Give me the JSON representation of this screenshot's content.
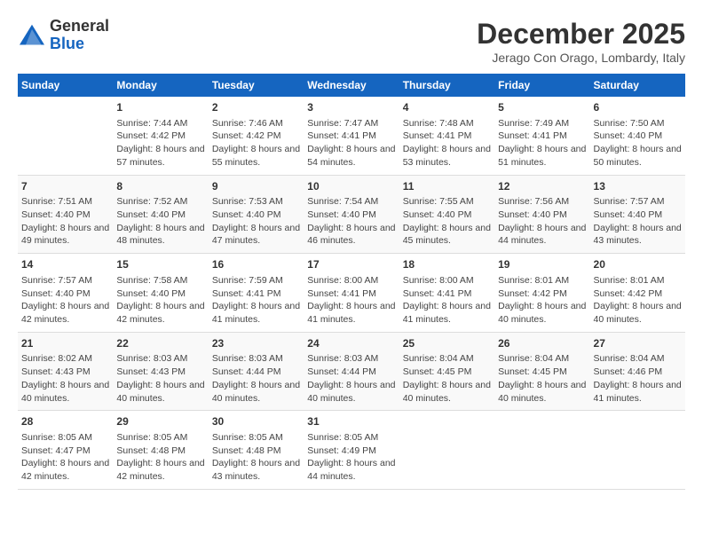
{
  "header": {
    "logo_line1": "General",
    "logo_line2": "Blue",
    "month": "December 2025",
    "location": "Jerago Con Orago, Lombardy, Italy"
  },
  "days_of_week": [
    "Sunday",
    "Monday",
    "Tuesday",
    "Wednesday",
    "Thursday",
    "Friday",
    "Saturday"
  ],
  "weeks": [
    [
      {
        "day": "",
        "sunrise": "",
        "sunset": "",
        "daylight": ""
      },
      {
        "day": "1",
        "sunrise": "Sunrise: 7:44 AM",
        "sunset": "Sunset: 4:42 PM",
        "daylight": "Daylight: 8 hours and 57 minutes."
      },
      {
        "day": "2",
        "sunrise": "Sunrise: 7:46 AM",
        "sunset": "Sunset: 4:42 PM",
        "daylight": "Daylight: 8 hours and 55 minutes."
      },
      {
        "day": "3",
        "sunrise": "Sunrise: 7:47 AM",
        "sunset": "Sunset: 4:41 PM",
        "daylight": "Daylight: 8 hours and 54 minutes."
      },
      {
        "day": "4",
        "sunrise": "Sunrise: 7:48 AM",
        "sunset": "Sunset: 4:41 PM",
        "daylight": "Daylight: 8 hours and 53 minutes."
      },
      {
        "day": "5",
        "sunrise": "Sunrise: 7:49 AM",
        "sunset": "Sunset: 4:41 PM",
        "daylight": "Daylight: 8 hours and 51 minutes."
      },
      {
        "day": "6",
        "sunrise": "Sunrise: 7:50 AM",
        "sunset": "Sunset: 4:40 PM",
        "daylight": "Daylight: 8 hours and 50 minutes."
      }
    ],
    [
      {
        "day": "7",
        "sunrise": "Sunrise: 7:51 AM",
        "sunset": "Sunset: 4:40 PM",
        "daylight": "Daylight: 8 hours and 49 minutes."
      },
      {
        "day": "8",
        "sunrise": "Sunrise: 7:52 AM",
        "sunset": "Sunset: 4:40 PM",
        "daylight": "Daylight: 8 hours and 48 minutes."
      },
      {
        "day": "9",
        "sunrise": "Sunrise: 7:53 AM",
        "sunset": "Sunset: 4:40 PM",
        "daylight": "Daylight: 8 hours and 47 minutes."
      },
      {
        "day": "10",
        "sunrise": "Sunrise: 7:54 AM",
        "sunset": "Sunset: 4:40 PM",
        "daylight": "Daylight: 8 hours and 46 minutes."
      },
      {
        "day": "11",
        "sunrise": "Sunrise: 7:55 AM",
        "sunset": "Sunset: 4:40 PM",
        "daylight": "Daylight: 8 hours and 45 minutes."
      },
      {
        "day": "12",
        "sunrise": "Sunrise: 7:56 AM",
        "sunset": "Sunset: 4:40 PM",
        "daylight": "Daylight: 8 hours and 44 minutes."
      },
      {
        "day": "13",
        "sunrise": "Sunrise: 7:57 AM",
        "sunset": "Sunset: 4:40 PM",
        "daylight": "Daylight: 8 hours and 43 minutes."
      }
    ],
    [
      {
        "day": "14",
        "sunrise": "Sunrise: 7:57 AM",
        "sunset": "Sunset: 4:40 PM",
        "daylight": "Daylight: 8 hours and 42 minutes."
      },
      {
        "day": "15",
        "sunrise": "Sunrise: 7:58 AM",
        "sunset": "Sunset: 4:40 PM",
        "daylight": "Daylight: 8 hours and 42 minutes."
      },
      {
        "day": "16",
        "sunrise": "Sunrise: 7:59 AM",
        "sunset": "Sunset: 4:41 PM",
        "daylight": "Daylight: 8 hours and 41 minutes."
      },
      {
        "day": "17",
        "sunrise": "Sunrise: 8:00 AM",
        "sunset": "Sunset: 4:41 PM",
        "daylight": "Daylight: 8 hours and 41 minutes."
      },
      {
        "day": "18",
        "sunrise": "Sunrise: 8:00 AM",
        "sunset": "Sunset: 4:41 PM",
        "daylight": "Daylight: 8 hours and 41 minutes."
      },
      {
        "day": "19",
        "sunrise": "Sunrise: 8:01 AM",
        "sunset": "Sunset: 4:42 PM",
        "daylight": "Daylight: 8 hours and 40 minutes."
      },
      {
        "day": "20",
        "sunrise": "Sunrise: 8:01 AM",
        "sunset": "Sunset: 4:42 PM",
        "daylight": "Daylight: 8 hours and 40 minutes."
      }
    ],
    [
      {
        "day": "21",
        "sunrise": "Sunrise: 8:02 AM",
        "sunset": "Sunset: 4:43 PM",
        "daylight": "Daylight: 8 hours and 40 minutes."
      },
      {
        "day": "22",
        "sunrise": "Sunrise: 8:03 AM",
        "sunset": "Sunset: 4:43 PM",
        "daylight": "Daylight: 8 hours and 40 minutes."
      },
      {
        "day": "23",
        "sunrise": "Sunrise: 8:03 AM",
        "sunset": "Sunset: 4:44 PM",
        "daylight": "Daylight: 8 hours and 40 minutes."
      },
      {
        "day": "24",
        "sunrise": "Sunrise: 8:03 AM",
        "sunset": "Sunset: 4:44 PM",
        "daylight": "Daylight: 8 hours and 40 minutes."
      },
      {
        "day": "25",
        "sunrise": "Sunrise: 8:04 AM",
        "sunset": "Sunset: 4:45 PM",
        "daylight": "Daylight: 8 hours and 40 minutes."
      },
      {
        "day": "26",
        "sunrise": "Sunrise: 8:04 AM",
        "sunset": "Sunset: 4:45 PM",
        "daylight": "Daylight: 8 hours and 40 minutes."
      },
      {
        "day": "27",
        "sunrise": "Sunrise: 8:04 AM",
        "sunset": "Sunset: 4:46 PM",
        "daylight": "Daylight: 8 hours and 41 minutes."
      }
    ],
    [
      {
        "day": "28",
        "sunrise": "Sunrise: 8:05 AM",
        "sunset": "Sunset: 4:47 PM",
        "daylight": "Daylight: 8 hours and 42 minutes."
      },
      {
        "day": "29",
        "sunrise": "Sunrise: 8:05 AM",
        "sunset": "Sunset: 4:48 PM",
        "daylight": "Daylight: 8 hours and 42 minutes."
      },
      {
        "day": "30",
        "sunrise": "Sunrise: 8:05 AM",
        "sunset": "Sunset: 4:48 PM",
        "daylight": "Daylight: 8 hours and 43 minutes."
      },
      {
        "day": "31",
        "sunrise": "Sunrise: 8:05 AM",
        "sunset": "Sunset: 4:49 PM",
        "daylight": "Daylight: 8 hours and 44 minutes."
      },
      {
        "day": "",
        "sunrise": "",
        "sunset": "",
        "daylight": ""
      },
      {
        "day": "",
        "sunrise": "",
        "sunset": "",
        "daylight": ""
      },
      {
        "day": "",
        "sunrise": "",
        "sunset": "",
        "daylight": ""
      }
    ]
  ]
}
